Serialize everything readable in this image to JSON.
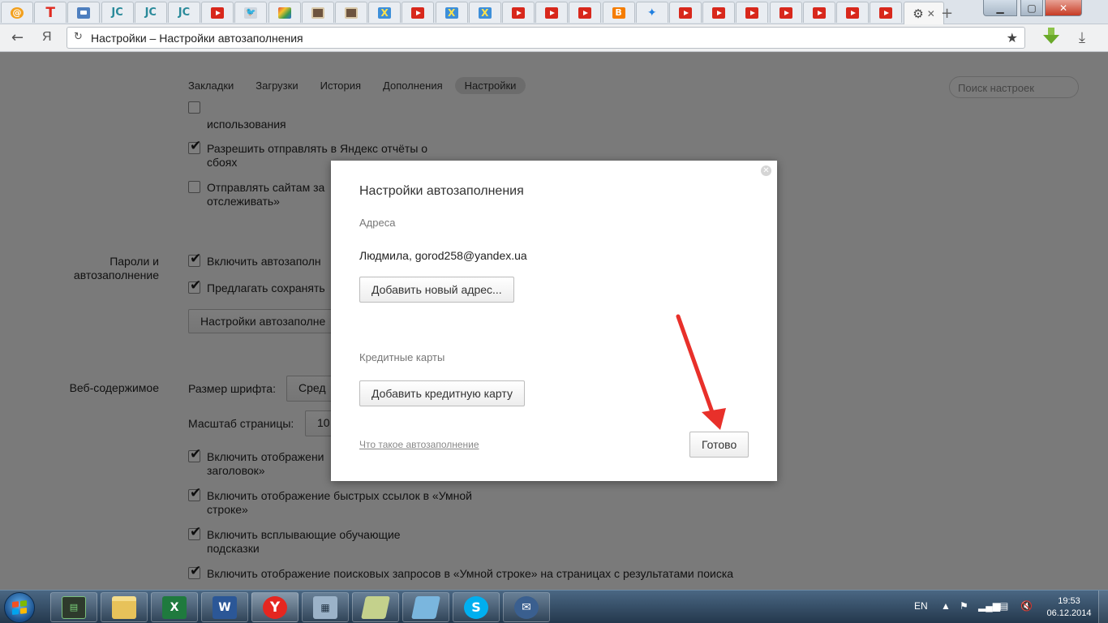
{
  "browser": {
    "tabs": [
      {
        "icon": "mail-icon",
        "glyph": "@"
      },
      {
        "icon": "t-icon",
        "glyph": "T"
      },
      {
        "icon": "chat-icon",
        "glyph": ""
      },
      {
        "icon": "jc-icon",
        "glyph": "JC"
      },
      {
        "icon": "jc-icon",
        "glyph": "JC"
      },
      {
        "icon": "jc-icon",
        "glyph": "JC"
      },
      {
        "icon": "youtube-icon",
        "glyph": ""
      },
      {
        "icon": "bird-icon",
        "glyph": "🐦"
      },
      {
        "icon": "instagram-color-icon",
        "glyph": ""
      },
      {
        "icon": "instagram-icon",
        "glyph": ""
      },
      {
        "icon": "instagram-icon",
        "glyph": ""
      },
      {
        "icon": "x-icon",
        "glyph": "X"
      },
      {
        "icon": "youtube-icon",
        "glyph": ""
      },
      {
        "icon": "x-icon",
        "glyph": "X"
      },
      {
        "icon": "x-icon",
        "glyph": "X"
      },
      {
        "icon": "youtube-icon",
        "glyph": ""
      },
      {
        "icon": "youtube-icon",
        "glyph": ""
      },
      {
        "icon": "youtube-icon",
        "glyph": ""
      },
      {
        "icon": "blogger-icon",
        "glyph": "B"
      },
      {
        "icon": "dropbox-icon",
        "glyph": "✦"
      },
      {
        "icon": "youtube-icon",
        "glyph": ""
      },
      {
        "icon": "youtube-icon",
        "glyph": ""
      },
      {
        "icon": "youtube-icon",
        "glyph": ""
      },
      {
        "icon": "youtube-icon",
        "glyph": ""
      },
      {
        "icon": "youtube-icon",
        "glyph": ""
      },
      {
        "icon": "youtube-icon",
        "glyph": ""
      },
      {
        "icon": "youtube-icon",
        "glyph": ""
      }
    ],
    "address": "Настройки – Настройки автозаполнения",
    "logo": "Я"
  },
  "settings": {
    "nav": [
      "Закладки",
      "Загрузки",
      "История",
      "Дополнения",
      "Настройки"
    ],
    "search_placeholder": "Поиск настроек",
    "partial_top_option": "использования",
    "opt_reports": "Разрешить отправлять в Яндекс отчёты о сбоях",
    "opt_dnt": "Отправлять сайтам за отслеживать»",
    "section_passwords": "Пароли и автозаполнение",
    "opt_autofill": "Включить автозаполн",
    "opt_save_passwords": "Предлагать сохранять",
    "btn_autofill_settings": "Настройки автозаполне",
    "section_web": "Веб-содержимое",
    "font_size_label": "Размер шрифта:",
    "font_size_value": "Сред",
    "zoom_label": "Масштаб страницы:",
    "zoom_value": "10",
    "opt_show_titles": "Включить отображени заголовок»",
    "opt_quick_links": "Включить отображение быстрых ссылок в «Умной строке»",
    "opt_tips": "Включить всплывающие обучающие подсказки",
    "opt_search_queries": "Включить отображение поисковых запросов в «Умной строке» на страницах с результатами поиска"
  },
  "dialog": {
    "title": "Настройки автозаполнения",
    "addresses_heading": "Адреса",
    "address_entry": "Людмила, gorod258@yandex.ua",
    "add_address_button": "Добавить новый адрес...",
    "cards_heading": "Кредитные карты",
    "add_card_button": "Добавить кредитную карту",
    "help_link": "Что такое автозаполнение",
    "done_button": "Готово",
    "arrow_color": "#e8302a"
  },
  "taskbar": {
    "apps": [
      "monitor-app-icon",
      "explorer-icon",
      "excel-icon",
      "word-icon",
      "yandex-browser-icon",
      "calculator-icon",
      "notepad-icon",
      "editor-icon",
      "skype-icon",
      "thunderbird-icon"
    ],
    "language": "EN",
    "time": "19:53",
    "date": "06.12.2014"
  }
}
